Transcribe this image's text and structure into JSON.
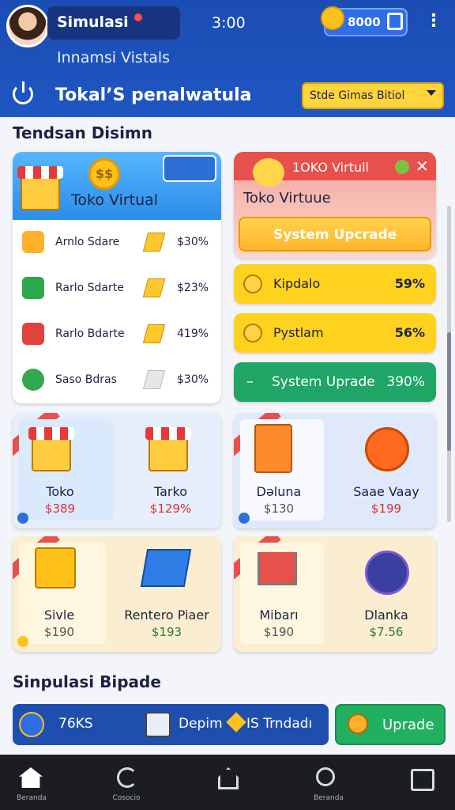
{
  "header": {
    "username": "Simulasi",
    "time": "3:00",
    "coins": "8000",
    "subtitle": "Innamsi Vistals",
    "page_title": "Tokal’S penalwatula",
    "dropdown_label": "Stde Gimas Bitiol"
  },
  "section_top": "Tendsan Disimn",
  "store_card": {
    "title": "Toko Virtual",
    "coin_text": "$$",
    "rows": [
      {
        "label": "Arnlo Sdare",
        "value": "$30%"
      },
      {
        "label": "Rarlo Sdarte",
        "value": "$23%"
      },
      {
        "label": "Rarlo Bdarte",
        "value": "419%"
      },
      {
        "label": "Saso Bdras",
        "value": "$30%"
      }
    ]
  },
  "upgrade_card": {
    "header": "1OKO Virtull",
    "subtitle": "Toko Virtuue",
    "button": "System Upcrade"
  },
  "stats": [
    {
      "label": "Kipdalo",
      "value": "59%"
    },
    {
      "label": "Pystlam",
      "value": "56%"
    },
    {
      "label": "System Uprade",
      "value": "390%",
      "prefix": "–"
    }
  ],
  "products": [
    {
      "name": "Toko",
      "price": "$389"
    },
    {
      "name": "Tarko",
      "price": "$129%"
    },
    {
      "name": "Dəluna",
      "price": "$130"
    },
    {
      "name": "Saae Vaay",
      "price": "$199"
    },
    {
      "name": "Sivle",
      "price": "$190"
    },
    {
      "name": "Rentero Piaer",
      "price": "$193"
    },
    {
      "name": "Mibarı",
      "price": "$190"
    },
    {
      "name": "Dlanka",
      "price": "$7.56"
    }
  ],
  "section_bottom": "Sinpulasi Bipade",
  "bottom_bar": {
    "left": "76KS",
    "mid": "Depim",
    "right": "IS Trndadı"
  },
  "bottom_button": "Uprade",
  "nav": [
    {
      "label": "Beranda"
    },
    {
      "label": "Cosocio"
    },
    {
      "label": ""
    },
    {
      "label": "Beranda"
    },
    {
      "label": ""
    }
  ],
  "colors": {
    "primary": "#1f56c2",
    "yellow": "#ffd53b",
    "green": "#20b060",
    "red": "#e8504c"
  }
}
